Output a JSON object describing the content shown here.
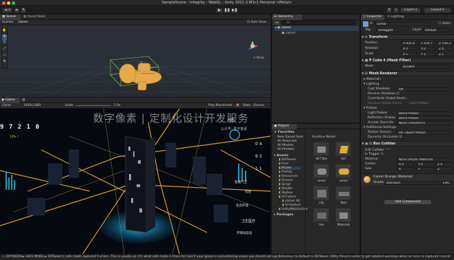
{
  "window": {
    "title": "SampleScene - Integrity - WebGL - Unity 2021.3.8f1c1 Personal <Metal>"
  },
  "toolbar": {
    "account_label": "",
    "layers_label": "Layers",
    "layout_label": "Layout"
  },
  "scene_tabs": [
    {
      "label": "Scene"
    },
    {
      "label": "Asset Store"
    }
  ],
  "scene": {
    "breadcrumb_root": "Scenes",
    "breadcrumb_item": "camer",
    "persp_label": "< Persp",
    "auto_save": "Auto Save",
    "gizmo_x": "x"
  },
  "game_tabs": [
    {
      "label": "Game"
    },
    {
      "label": "Console"
    }
  ],
  "game": {
    "display": "Game",
    "resolution": "1920x1080",
    "scale_label": "Scale",
    "scale_value": "1.5x",
    "play_maximized": "Play Maximized",
    "stats": "Stats",
    "gizmos": "Gizmos",
    "big_number": "9 7 2 1 0",
    "watermark": "数字像素 | 定制化设计开发服务",
    "watermark_sub": "公众号: 数字像素",
    "hud_labels": [
      "卫生医疗",
      "社会",
      "生态环境",
      "智能门卫",
      "社区"
    ],
    "hud_right": [
      "0 4",
      "9 3",
      "1 1"
    ],
    "hud_left_pct": "12% ↑",
    "hud_bottom_right": "环境动态化"
  },
  "hierarchy": {
    "tab": "Hierarchy",
    "search_placeholder": "All",
    "item": "camer",
    "child": "camer"
  },
  "project": {
    "tab": "Project",
    "breadcrumb": [
      "Assets",
      "Model"
    ],
    "favorites_title": "Favorites",
    "favorites": [
      "New Saved Sear",
      "All Materials",
      "All Models",
      "All Prefabs"
    ],
    "assets_title": "Assets",
    "folders": [
      "DOTween",
      "Font",
      "Model",
      "PreFab",
      "Resources",
      "Scenes",
      "Script",
      "Shader",
      "Skybox",
      "UI Future",
      "camer All",
      "UI texture",
      "UnityWebSocket"
    ],
    "packages": "Packages",
    "items": [
      {
        "label": "047.fbm"
      },
      {
        "label": "047"
      },
      {
        "label": "camer"
      },
      {
        "label": "camer"
      },
      {
        "label": "city"
      },
      {
        "label": "floor"
      },
      {
        "label": "line"
      },
      {
        "label": "Materials"
      }
    ]
  },
  "inspector": {
    "tab": "Inspector",
    "lighting_tab": "Lighting",
    "object_name": "camer",
    "static": "Static",
    "tag_label": "Tag",
    "tag_value": "Untagged",
    "layer_label": "Layer",
    "layer_value": "Default",
    "transform": {
      "title": "Transform",
      "position_label": "Position",
      "rotation_label": "Rotation",
      "scale_label": "Scale",
      "position": [
        "X 431.4",
        "Y 154.7",
        "Z 150.3"
      ],
      "rotation": [
        "X 0",
        "Y 0",
        "Z 0"
      ],
      "scale": [
        "X 1",
        "Y 1",
        "Z 1"
      ]
    },
    "mesh_filter": {
      "title": "P Cube 4 (Mesh Filter)",
      "mesh_label": "Mesh",
      "mesh_value": "pCube4"
    },
    "mesh_renderer": {
      "title": "Mesh Renderer",
      "materials": "Materials",
      "lighting": "Lighting",
      "cast_shadows_label": "Cast Shadows",
      "cast_shadows": "Off",
      "receive_shadows": "Receive Shadows",
      "contribute_gi": "Contribute Global Illumi...",
      "receive_gi": "Receive Global Illumi...",
      "receive_gi_value": "Light Probes",
      "probes": "Probes",
      "light_probes_label": "Light Probes",
      "light_probes": "Blend Probes",
      "reflection_label": "Reflection Probes",
      "reflection": "Blend Probes",
      "anchor_label": "Anchor Override",
      "anchor": "None (Transform)",
      "additional": "Additional Settings",
      "motion_label": "Motion Vectors",
      "motion": "Per Object Motion",
      "dynamic_occ": "Dynamic Occlusion"
    },
    "box_collider": {
      "title": "Box Collider",
      "edit": "Edit Collider",
      "trigger": "Is Trigger",
      "material_label": "Material",
      "material": "None (Physic Material)",
      "center_label": "Center",
      "center": [
        "X 0",
        "Y 0",
        "Z 0"
      ],
      "size_label": "Size",
      "size": [
        "X 2.23939",
        "Y 1.79091",
        "Z 1.09862"
      ]
    },
    "material": {
      "name": "Camer Orange (Material)",
      "shader_label": "Shader",
      "shader": "Standard",
      "edit": "Edit..."
    },
    "add_component": "Add Component"
  },
  "status": {
    "text": "DOTWEEN ► SAFE MODE ► DOTween's safe mode captured 5 errors. This is usually ok (it's what safe mode is there for) but if your game is encountering issues you should set Log Behaviour to Default in DOTween Utility Panel in order to get detailed warnings when an error is captured (consid"
  },
  "colors": {
    "accent": "#2c5d87",
    "glow": "#ffb83a",
    "cyan": "#26c6f0",
    "window_bg": "#191919"
  }
}
